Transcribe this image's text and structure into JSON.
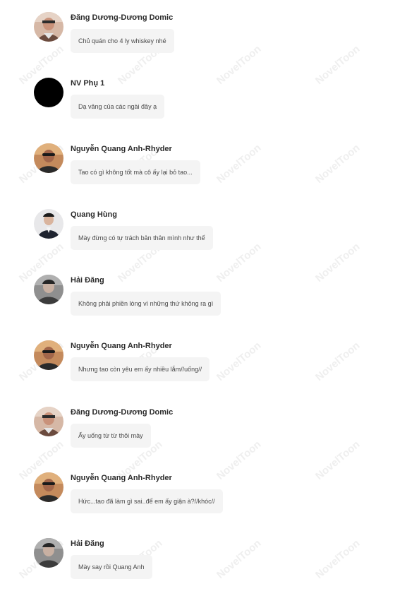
{
  "watermark": "NovelToon",
  "messages": [
    {
      "sender": "Đăng Dương-Dương Domic",
      "text": "Chủ quán cho 4 ly whiskey nhé",
      "avatar": "avatar-domic"
    },
    {
      "sender": "NV Phụ 1",
      "text": "Dạ vâng của các ngài đây ạ",
      "avatar": "avatar-black"
    },
    {
      "sender": "Nguyễn Quang Anh-Rhyder",
      "text": "Tao có gì không tốt mà cô ấy lại bỏ tao...",
      "avatar": "avatar-rhyder"
    },
    {
      "sender": "Quang Hùng",
      "text": "Mày đừng có tự trách bản thân mình như thế",
      "avatar": "avatar-quanghung"
    },
    {
      "sender": "Hải Đăng",
      "text": "Không phải phiền lòng vì những thứ không ra gì",
      "avatar": "avatar-haidang"
    },
    {
      "sender": "Nguyễn Quang Anh-Rhyder",
      "text": "Nhưng tao còn yêu em ấy nhiều lắm//uống//",
      "avatar": "avatar-rhyder"
    },
    {
      "sender": "Đăng Dương-Dương Domic",
      "text": "Ấy uống từ từ thôi mày",
      "avatar": "avatar-domic"
    },
    {
      "sender": "Nguyễn Quang Anh-Rhyder",
      "text": "Hức...tao đã làm gì sai..để em ấy giận à?//khóc//",
      "avatar": "avatar-rhyder"
    },
    {
      "sender": "Hải Đăng",
      "text": "Mày say rồi Quang Anh",
      "avatar": "avatar-haidang"
    }
  ]
}
